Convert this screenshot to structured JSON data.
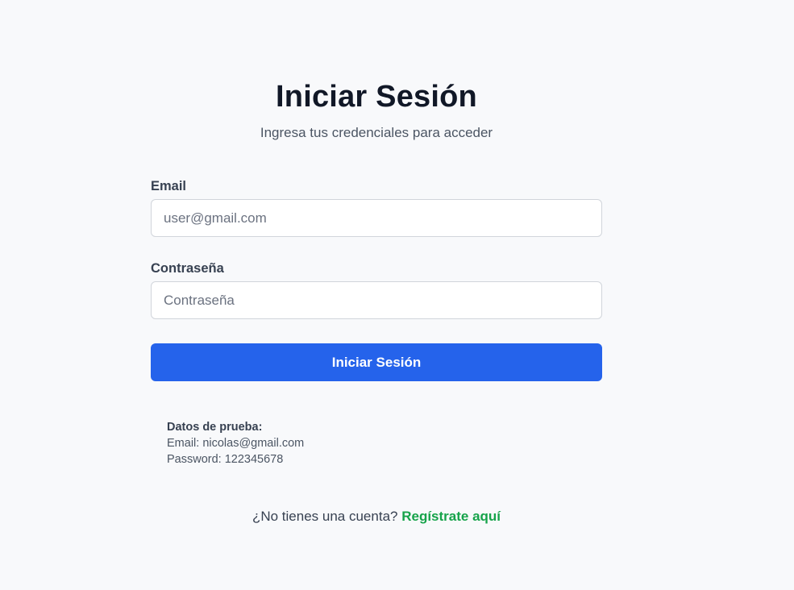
{
  "header": {
    "title": "Iniciar Sesión",
    "subtitle": "Ingresa tus credenciales para acceder"
  },
  "form": {
    "email_label": "Email",
    "email_placeholder": "user@gmail.com",
    "email_value": "",
    "password_label": "Contraseña",
    "password_placeholder": "Contraseña",
    "password_value": "",
    "submit_label": "Iniciar Sesión"
  },
  "test_data": {
    "title": "Datos de prueba:",
    "email_line": "Email: nicolas@gmail.com",
    "password_line": "Password: 122345678"
  },
  "footer": {
    "prompt": "¿No tienes una cuenta?",
    "register_link": "Regístrate aquí"
  },
  "colors": {
    "background": "#f8f9fb",
    "primary": "#2563eb",
    "link": "#16a34a"
  }
}
